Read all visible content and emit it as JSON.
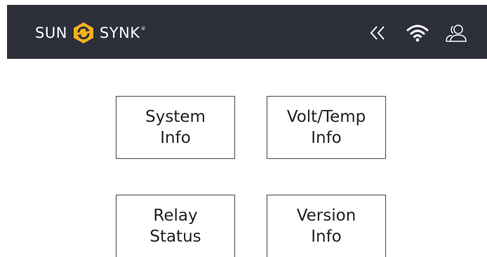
{
  "header": {
    "brand_left": "SUN",
    "brand_right": "SYNK",
    "brand_registered": "®",
    "icons": {
      "logo": "sunsynk-logo-mark",
      "back": "double-chevron-left-icon",
      "wifi": "wifi-icon",
      "user": "users-icon"
    }
  },
  "menu": {
    "system_info": "System\nInfo",
    "volt_temp_info": "Volt/Temp\nInfo",
    "relay_status": "Relay\nStatus",
    "version_info": "Version\nInfo"
  },
  "colors": {
    "header_bg": "#2d2f3a",
    "accent": "#f5b21c",
    "button_border": "#4a4a4a",
    "text": "#222222"
  }
}
